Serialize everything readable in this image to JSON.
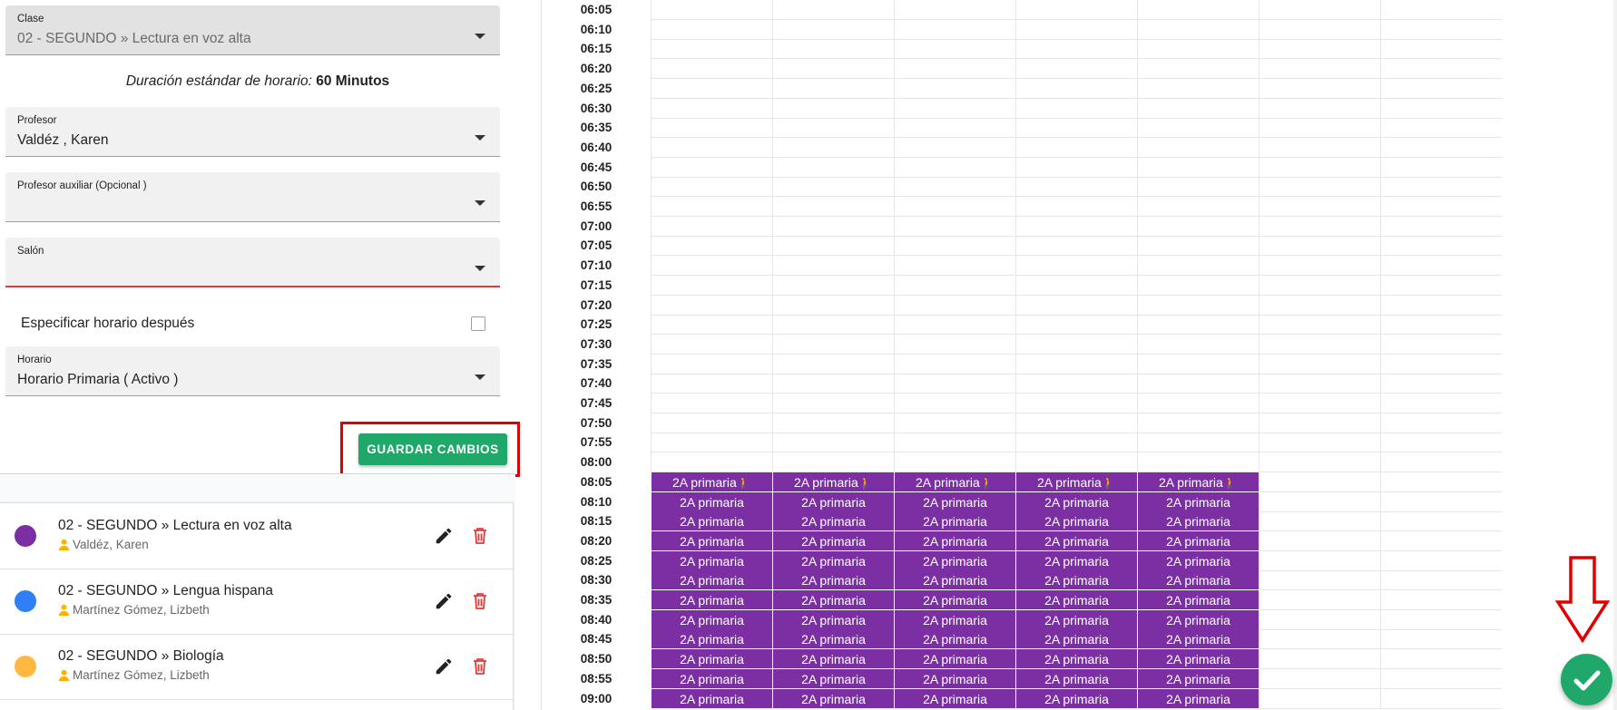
{
  "form": {
    "clase": {
      "label": "Clase",
      "value": "02 - SEGUNDO » Lectura en voz alta"
    },
    "duration": {
      "prefix": "Duración estándar de horario:",
      "value": "60 Minutos"
    },
    "profesor": {
      "label": "Profesor",
      "value": "Valdéz , Karen"
    },
    "profesor_aux": {
      "label": "Profesor auxiliar (Opcional )",
      "value": ""
    },
    "salon": {
      "label": "Salón",
      "value": ""
    },
    "specify_later": {
      "label": "Especificar horario después",
      "checked": false
    },
    "horario": {
      "label": "Horario",
      "value": "Horario Primaria ( Activo )"
    },
    "save_button": "GUARDAR CAMBIOS"
  },
  "class_list": [
    {
      "title": "02 - SEGUNDO » Lectura en voz alta",
      "teacher": "Valdéz, Karen",
      "color": "#7b2fa3"
    },
    {
      "title": "02 - SEGUNDO » Lengua hispana",
      "teacher": "Martínez Gómez, Lizbeth",
      "color": "#2f80f5"
    },
    {
      "title": "02 - SEGUNDO » Biología",
      "teacher": "Martínez Gómez, Lizbeth",
      "color": "#ffb940"
    }
  ],
  "schedule": {
    "times": [
      "06:05",
      "06:10",
      "06:15",
      "06:20",
      "06:25",
      "06:30",
      "06:35",
      "06:40",
      "06:45",
      "06:50",
      "06:55",
      "07:00",
      "07:05",
      "07:10",
      "07:15",
      "07:20",
      "07:25",
      "07:30",
      "07:35",
      "07:40",
      "07:45",
      "07:50",
      "07:55",
      "08:00",
      "08:05",
      "08:10",
      "08:15",
      "08:20",
      "08:25",
      "08:30",
      "08:35",
      "08:40",
      "08:45",
      "08:50",
      "08:55",
      "09:00"
    ],
    "block_label": "2A primaria",
    "block_start_time": "08:05",
    "block_color": "#7b2fa3",
    "filled_columns": 5,
    "total_columns": 7
  },
  "colors": {
    "accent": "#20a86b",
    "error": "#e53935",
    "highlight": "#e00000"
  },
  "icons": {
    "caret": "chevron-down-icon",
    "edit": "pencil-icon",
    "delete": "trash-icon",
    "person": "person-icon",
    "walk": "walking-person-icon",
    "fab": "check-icon"
  }
}
